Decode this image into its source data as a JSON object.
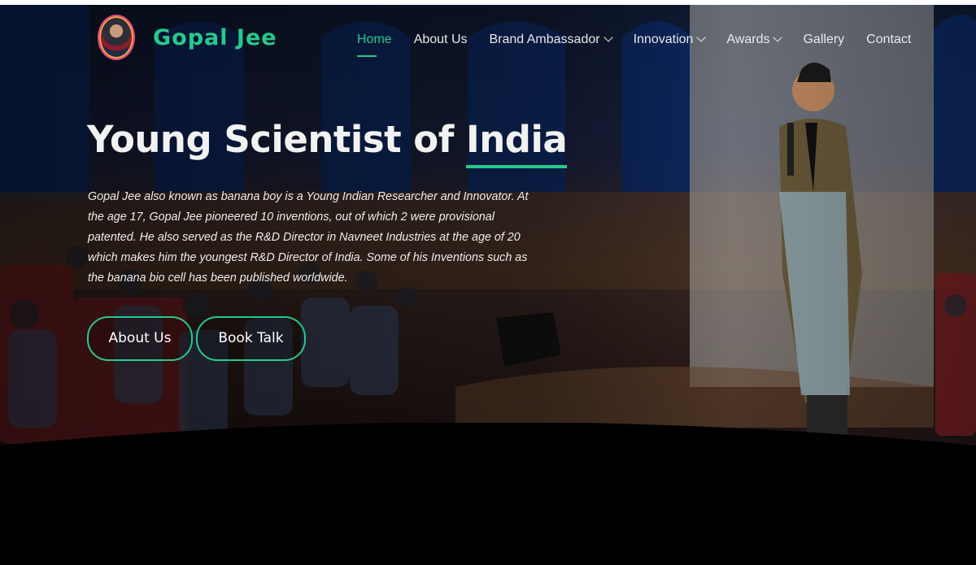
{
  "brand": {
    "name": "Gopal Jee",
    "avatar_icon": "profile-avatar"
  },
  "nav": {
    "items": [
      {
        "label": "Home",
        "active": true,
        "has_dropdown": false
      },
      {
        "label": "About Us",
        "active": false,
        "has_dropdown": false
      },
      {
        "label": "Brand Ambassador",
        "active": false,
        "has_dropdown": true
      },
      {
        "label": "Innovation",
        "active": false,
        "has_dropdown": true
      },
      {
        "label": "Awards",
        "active": false,
        "has_dropdown": true
      },
      {
        "label": "Gallery",
        "active": false,
        "has_dropdown": false
      },
      {
        "label": "Contact",
        "active": false,
        "has_dropdown": false
      }
    ]
  },
  "hero": {
    "title_main": "Young Scientist of ",
    "title_accent": "India",
    "description": "Gopal Jee also known as banana boy is a Young Indian Researcher and Innovator. At the age 17, Gopal Jee pioneered 10 inventions, out of which 2 were provisional patented. He also served as the R&D Director in Navneet Industries at the age of 20 which makes him the youngest R&D Director of India. Some of his Inventions such as the banana bio cell has been published worldwide.",
    "buttons": {
      "about": "About Us",
      "book": "Book Talk"
    }
  },
  "colors": {
    "accent": "#27c98b",
    "text": "#f2f2f2",
    "background": "#000000"
  }
}
